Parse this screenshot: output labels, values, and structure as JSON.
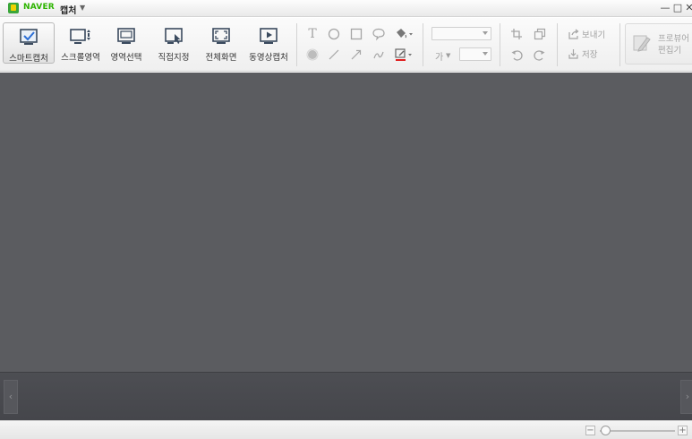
{
  "titlebar": {
    "brand": "NAVER",
    "app_name": "캡처",
    "window_controls": {
      "minimize": "—",
      "maximize": "□",
      "close": "✕"
    }
  },
  "modes": [
    {
      "label": "스마트캡처",
      "icon": "smart-capture-icon",
      "active": true
    },
    {
      "label": "스크롤영역",
      "icon": "scroll-area-icon",
      "active": false
    },
    {
      "label": "영역선택",
      "icon": "region-select-icon",
      "active": false
    },
    {
      "label": "직접지정",
      "icon": "direct-specify-icon",
      "active": false
    },
    {
      "label": "전체화면",
      "icon": "fullscreen-icon",
      "active": false
    },
    {
      "label": "동영상캡처",
      "icon": "video-capture-icon",
      "active": false
    }
  ],
  "drawing_tools": {
    "row1": [
      "text-tool-icon",
      "circle-tool-icon",
      "rectangle-tool-icon",
      "speech-bubble-icon",
      "fill-bucket-icon"
    ],
    "row2": [
      "blur-tool-icon",
      "line-tool-icon",
      "arrow-tool-icon",
      "freehand-tool-icon",
      "pen-color-icon"
    ],
    "text_glyph": "T"
  },
  "text_format": {
    "font_size_label": "가"
  },
  "edit_tools": [
    "crop-icon",
    "resize-icon",
    "undo-icon",
    "redo-icon"
  ],
  "actions": {
    "send": "보내기",
    "save": "저장"
  },
  "pro_viewer": {
    "line1": "프로뷰어",
    "line2": "편집기"
  },
  "colors": {
    "brand_green": "#2db400",
    "canvas": "#5b5c60",
    "strip": "#48494e",
    "pen_color_underline": "#e02020"
  },
  "zoom": {
    "minus": "−",
    "plus": "+",
    "level": 0.02
  }
}
